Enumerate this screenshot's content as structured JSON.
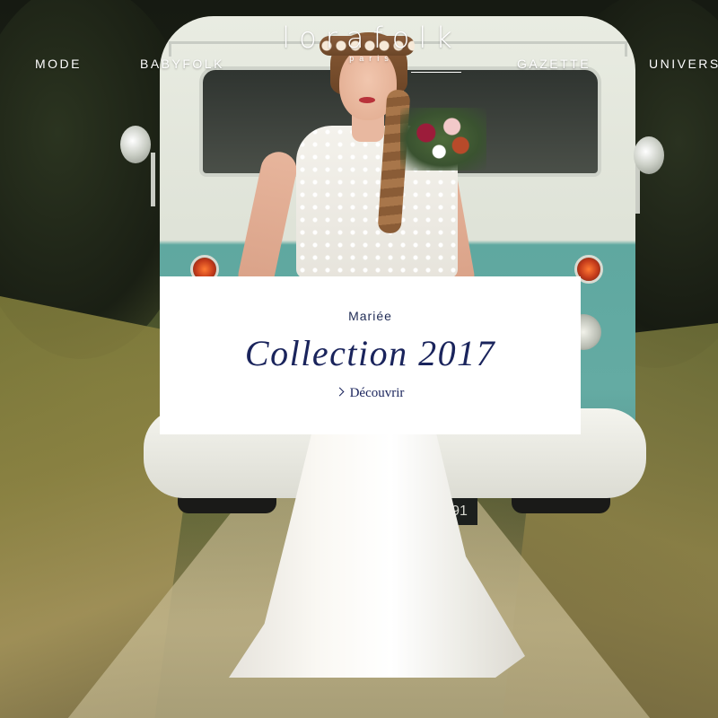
{
  "nav": {
    "items": [
      {
        "label": "MODE"
      },
      {
        "label": "BABYFOLK"
      },
      {
        "label": "GAZETTE"
      },
      {
        "label": "UNIVERS"
      }
    ]
  },
  "logo": {
    "main": "lorafolk",
    "sub": "paris"
  },
  "hero": {
    "plate_text": "91"
  },
  "card": {
    "eyebrow": "Mariée",
    "title": "Collection 2017",
    "cta_label": "Découvrir"
  },
  "colors": {
    "title_navy": "#1a245c",
    "card_background": "#ffffff",
    "nav_text": "#ffffff",
    "van_teal": "#64aba3"
  },
  "icons": {
    "cta": "chevron-right-icon"
  }
}
